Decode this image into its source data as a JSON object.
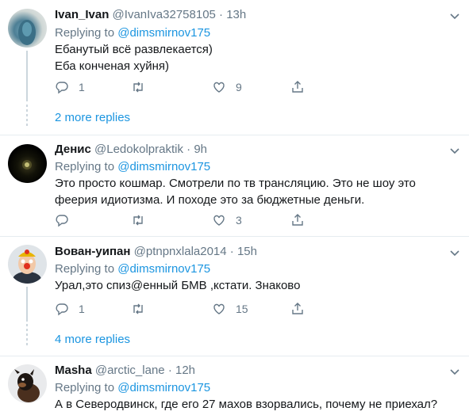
{
  "replies": [
    {
      "name": "Ivan_Ivan",
      "handle": "@IvanIva32758105",
      "sep": "·",
      "time": "13h",
      "replying_prefix": "Replying to ",
      "replying_to": "@dimsmirnov175",
      "text_lines": [
        "Ебанутый всё развлекается)",
        "Еба конченая хуйня)"
      ],
      "reply_count": "1",
      "retweet_count": "",
      "like_count": "9",
      "more_replies": "2 more replies"
    },
    {
      "name": "Денис",
      "handle": "@Ledokolpraktik",
      "sep": "·",
      "time": "9h",
      "replying_prefix": "Replying to ",
      "replying_to": "@dimsmirnov175",
      "text_lines": [
        "Это просто кошмар. Смотрели по тв трансляцию. Это не шоу это",
        "феерия идиотизма. И походе это за бюджетные деньги."
      ],
      "reply_count": "",
      "retweet_count": "",
      "like_count": "3"
    },
    {
      "name": "Вован-уипан",
      "handle": "@ptnpnxlala2014",
      "sep": "·",
      "time": "15h",
      "replying_prefix": "Replying to ",
      "replying_to": "@dimsmirnov175",
      "text_lines": [
        "Урал,это спиз@енный БМВ ,кстати. Знаково"
      ],
      "reply_count": "1",
      "retweet_count": "",
      "like_count": "15",
      "more_replies": "4 more replies"
    },
    {
      "name": "Masha",
      "handle": "@arctic_lane",
      "sep": "·",
      "time": "12h",
      "replying_prefix": "Replying to ",
      "replying_to": "@dimsmirnov175",
      "text_lines": [
        "А в Северодвинск, где его 27 махов взорвались, почему не приехал?"
      ]
    }
  ],
  "icons": {
    "reply": "reply-icon",
    "retweet": "retweet-icon",
    "like": "like-icon",
    "share": "share-icon",
    "more": "chevron-down-icon"
  },
  "colors": {
    "link": "#1b95e0",
    "secondary": "#657786",
    "separator": "#e6ecf0"
  }
}
